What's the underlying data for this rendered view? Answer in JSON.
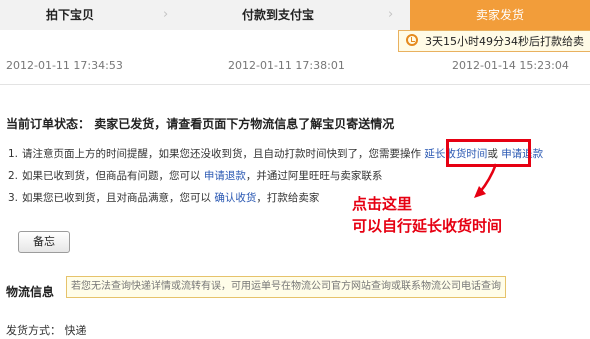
{
  "steps": [
    "拍下宝贝",
    "付款到支付宝",
    "卖家发货"
  ],
  "countdown": "3天15小时49分34秒后打款给卖",
  "times": [
    "2012-01-11 17:34:53",
    "2012-01-11 17:38:01",
    "2012-01-14 15:23:04"
  ],
  "status": {
    "label": "当前订单状态：",
    "text": "卖家已发货，请查看页面下方物流信息了解宝贝寄送情况"
  },
  "items": [
    {
      "num": "1.",
      "text": "请注意页面上方的时间提醒，如果您还没收到货，且自动打款时间快到了，您需要操作",
      "link1": "延长收货时间",
      "mid": "或",
      "link2": "申请退款"
    },
    {
      "num": "2.",
      "text": "如果已收到货，但商品有问题，您可以",
      "link": "申请退款",
      "after": "，并通过阿里旺旺与卖家联系"
    },
    {
      "num": "3.",
      "text": "如果您已收到货，且对商品满意，您可以",
      "link": "确认收货",
      "after": "，打款给卖家"
    }
  ],
  "annotation": [
    "点击这里",
    "可以自行延长收货时间"
  ],
  "memo_button": "备忘",
  "logistics": {
    "title": "物流信息",
    "note": "若您无法查询快递详情或流转有误，可用运单号在物流公司官方网站查询或联系物流公司电话查询"
  },
  "shipping": "发货方式： 快递",
  "colors": {
    "active_step": "#f29d3a",
    "link": "#2b59b3",
    "annotation": "#e60012"
  }
}
